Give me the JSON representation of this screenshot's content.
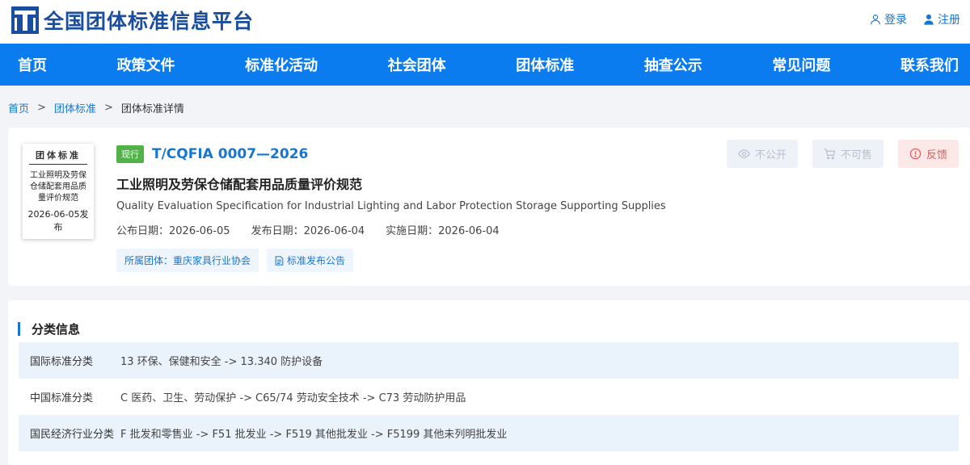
{
  "header": {
    "logo_text": "全国团体标准信息平台",
    "login": "登录",
    "register": "注册"
  },
  "nav": {
    "items": [
      "首页",
      "政策文件",
      "标准化活动",
      "社会团体",
      "团体标准",
      "抽查公示",
      "常见问题",
      "联系我们"
    ]
  },
  "breadcrumb": {
    "home": "首页",
    "section": "团体标准",
    "current": "团体标准详情",
    "sep": ">"
  },
  "standard": {
    "thumb_title": "团体标准",
    "thumb_body": "工业照明及劳保仓储配套用品质量评价规范",
    "thumb_date": "2026-06-05发布",
    "status": "现行",
    "code": "T/CQFIA 0007—2026",
    "title_cn": "工业照明及劳保仓储配套用品质量评价规范",
    "title_en": "Quality Evaluation Specification for Industrial Lighting and Labor Protection Storage Supporting Supplies",
    "publish_date": "公布日期：2026-06-05",
    "release_date": "发布日期：2026-06-04",
    "effective_date": "实施日期：2026-06-04",
    "org_tag": "所属团体：重庆家具行业协会",
    "notice_tag": "标准发布公告"
  },
  "actions": {
    "not_public": "不公开",
    "not_for_sale": "不可售",
    "feedback": "反馈"
  },
  "classification": {
    "title": "分类信息",
    "rows": [
      {
        "label": "国际标准分类",
        "value": "13 环保、保健和安全 -> 13.340 防护设备"
      },
      {
        "label": "中国标准分类",
        "value": "C 医药、卫生、劳动保护 -> C65/74 劳动安全技术 -> C73 劳动防护用品"
      },
      {
        "label": "国民经济行业分类",
        "value": "F 批发和零售业 -> F51 批发业 -> F519 其他批发业 -> F5199 其他未列明批发业"
      }
    ]
  },
  "colors": {
    "primary": "#0a7cf0",
    "link": "#1677d2",
    "logo": "#1a4d9e",
    "status_green": "#52b24a",
    "feedback_red": "#e25a5a"
  },
  "icons": {
    "login": "user-outline-icon",
    "register": "user-filled-icon",
    "not_public": "eye-icon",
    "not_for_sale": "cart-icon",
    "feedback": "alert-circle-icon",
    "notice": "document-icon"
  }
}
